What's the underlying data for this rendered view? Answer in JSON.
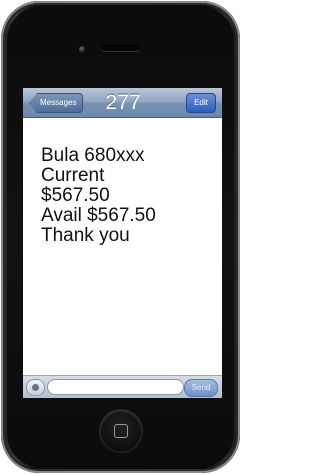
{
  "navbar": {
    "back_label": "Messages",
    "title": "277",
    "edit_label": "Edit"
  },
  "message": {
    "lines": [
      "Bula 680xxx",
      "Current",
      "$567.50",
      "Avail $567.50",
      "Thank you"
    ]
  },
  "composer": {
    "send_label": "Send"
  },
  "colors": {
    "navbar": "#8ea3c0",
    "edit_button": "#2c5fc0",
    "phone_body": "#0b0b0b"
  }
}
